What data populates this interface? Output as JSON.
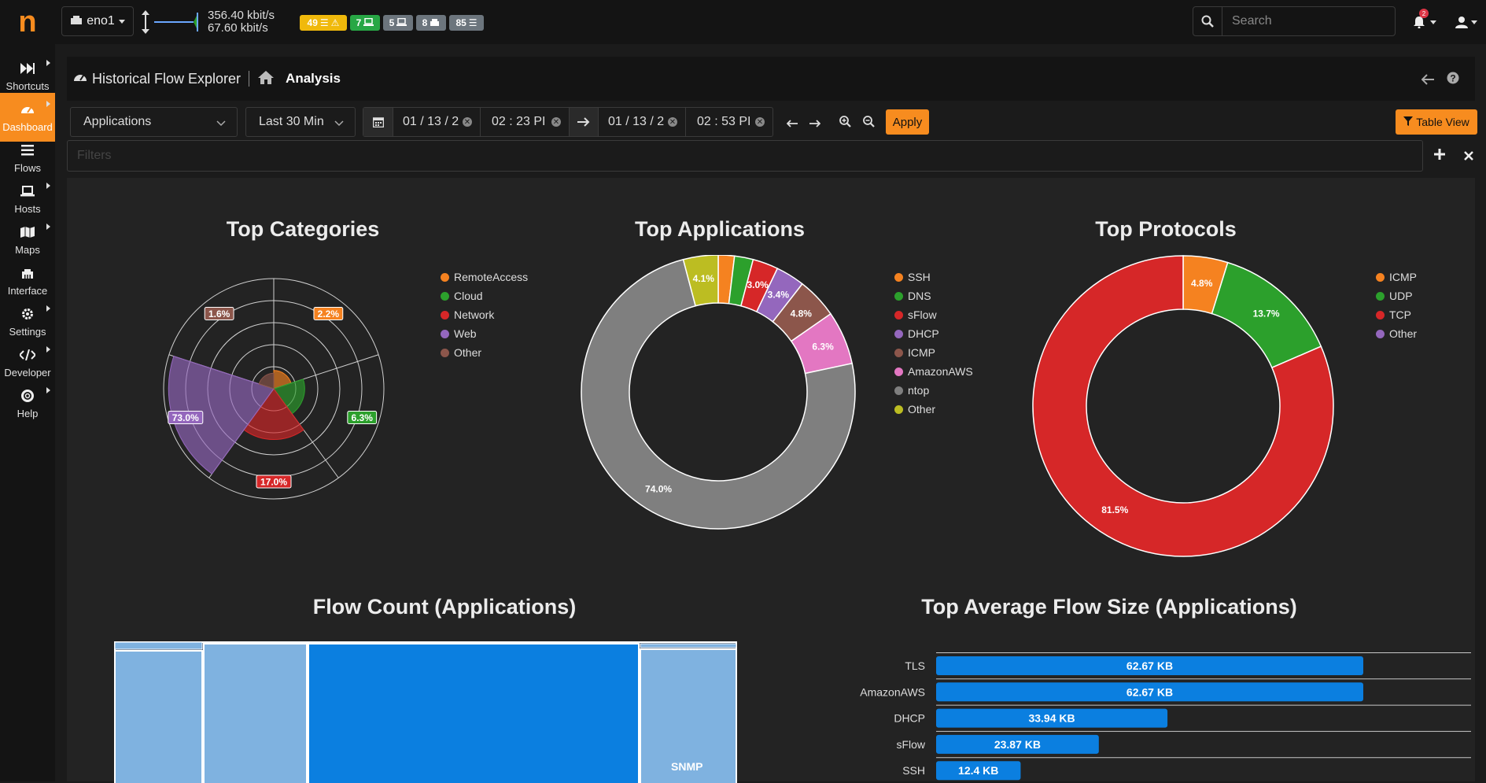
{
  "app": {
    "logo": "n"
  },
  "sidebar": {
    "items": [
      {
        "label": "Shortcuts"
      },
      {
        "label": "Dashboard"
      },
      {
        "label": "Flows"
      },
      {
        "label": "Hosts"
      },
      {
        "label": "Maps"
      },
      {
        "label": "Interface"
      },
      {
        "label": "Settings"
      },
      {
        "label": "Developer"
      },
      {
        "label": "Help"
      }
    ]
  },
  "topbar": {
    "interface": "eno1",
    "upload": "356.40 kbit/s",
    "download": "67.60 kbit/s",
    "badges": [
      {
        "value": "49",
        "color": "#f0b90b"
      },
      {
        "value": "7",
        "color": "#28a745"
      },
      {
        "value": "5",
        "color": "#6c757d"
      },
      {
        "value": "8",
        "color": "#6c757d"
      },
      {
        "value": "85",
        "color": "#6c757d"
      }
    ],
    "search_placeholder": "Search",
    "notification_count": "2"
  },
  "breadcrumb": {
    "title": "Historical Flow Explorer",
    "page": "Analysis"
  },
  "controls": {
    "view_select": "Applications",
    "range_select": "Last 30 Min",
    "start_date": "01 / 13 / 2",
    "start_time": "02 : 23  PI",
    "end_date": "01 / 13 / 2",
    "end_time": "02 : 53  PI",
    "apply_label": "Apply",
    "table_view_label": "Table View",
    "filters_placeholder": "Filters",
    "accent_color": "#f78c1f"
  },
  "chart_data": [
    {
      "type": "polar-area",
      "title": "Top Categories",
      "categories": [
        "RemoteAccess",
        "Cloud",
        "Network",
        "Web",
        "Other"
      ],
      "colors": [
        "#f58220",
        "#2ca02c",
        "#d62728",
        "#9467bd",
        "#8c564b"
      ],
      "values": [
        2.2,
        6.3,
        17.0,
        73.0,
        1.6
      ],
      "value_labels": [
        "2.2%",
        "6.3%",
        "17.0%",
        "73.0%",
        "1.6%"
      ],
      "legend": "right"
    },
    {
      "type": "pie",
      "title": "Top Applications",
      "categories": [
        "SSH",
        "DNS",
        "sFlow",
        "DHCP",
        "ICMP",
        "AmazonAWS",
        "ntop",
        "Other"
      ],
      "colors": [
        "#f58220",
        "#2ca02c",
        "#d62728",
        "#9467bd",
        "#8c564b",
        "#e377c2",
        "#7f7f7f",
        "#bcbd22"
      ],
      "values": [
        1.9,
        2.2,
        3.0,
        3.4,
        4.8,
        6.3,
        74.0,
        4.1
      ],
      "value_labels": [
        "",
        "",
        "3.0%",
        "3.4%",
        "4.8%",
        "6.3%",
        "74.0%",
        "4.1%"
      ],
      "legend": "right"
    },
    {
      "type": "pie",
      "title": "Top Protocols",
      "categories": [
        "ICMP",
        "UDP",
        "TCP",
        "Other"
      ],
      "colors": [
        "#f58220",
        "#2ca02c",
        "#d62728",
        "#9467bd"
      ],
      "values": [
        4.8,
        13.7,
        81.5,
        0
      ],
      "value_labels": [
        "4.8%",
        "13.7%",
        "81.5%",
        ""
      ],
      "legend": "right"
    },
    {
      "type": "treemap",
      "title": "Flow Count (Applications)",
      "labels": [
        "SNMP"
      ]
    },
    {
      "type": "bar",
      "title": "Top Average Flow Size (Applications)",
      "categories": [
        "TLS",
        "AmazonAWS",
        "DHCP",
        "sFlow",
        "SSH"
      ],
      "values": [
        62.67,
        62.67,
        33.94,
        23.87,
        12.4
      ],
      "value_labels": [
        "62.67 KB",
        "62.67 KB",
        "33.94 KB",
        "23.87 KB",
        "12.4 KB"
      ],
      "bar_color": "#0b7fe0"
    }
  ]
}
